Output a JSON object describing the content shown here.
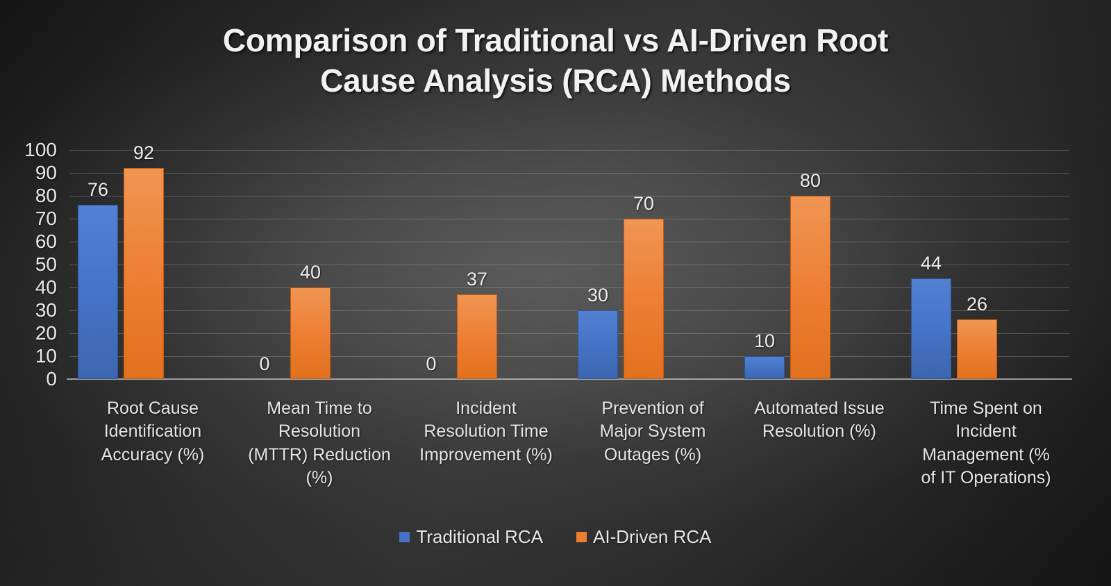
{
  "chart_data": {
    "type": "bar",
    "title": "Comparison of Traditional vs AI-Driven Root Cause Analysis (RCA) Methods",
    "title_line1": "Comparison of Traditional vs AI-Driven Root",
    "title_line2": "Cause Analysis (RCA) Methods",
    "xlabel": "",
    "ylabel": "",
    "ylim": [
      0,
      100
    ],
    "y_ticks": [
      100,
      90,
      80,
      70,
      60,
      50,
      40,
      30,
      20,
      10,
      0
    ],
    "grid": true,
    "legend_position": "bottom",
    "data_labels": true,
    "categories": [
      "Root Cause Identification Accuracy (%)",
      "Mean Time to Resolution (MTTR) Reduction (%)",
      "Incident Resolution Time Improvement (%)",
      "Prevention of Major System Outages (%)",
      "Automated Issue Resolution (%)",
      "Time Spent on Incident Management (% of IT Operations)"
    ],
    "category_lines": [
      [
        "Root Cause",
        "Identification",
        "Accuracy (%)"
      ],
      [
        "Mean Time to",
        "Resolution",
        "(MTTR) Reduction",
        "(%)"
      ],
      [
        "Incident",
        "Resolution Time",
        "Improvement (%)"
      ],
      [
        "Prevention of",
        "Major System",
        "Outages (%)"
      ],
      [
        "Automated Issue",
        "Resolution (%)"
      ],
      [
        "Time Spent on",
        "Incident",
        "Management (%",
        "of IT Operations)"
      ]
    ],
    "series": [
      {
        "name": "Traditional RCA",
        "color": "#4472C4",
        "values": [
          76,
          0,
          0,
          30,
          10,
          44
        ]
      },
      {
        "name": "AI-Driven RCA",
        "color": "#ED7D31",
        "values": [
          92,
          40,
          37,
          70,
          80,
          26
        ]
      }
    ]
  },
  "theme": {
    "background_dark": "#1D1D1D",
    "background_mid": "#343434",
    "text_color": "#E8E8E8",
    "gridline_color": "#D7D7D7",
    "axis_color": "#E1E1E1"
  }
}
